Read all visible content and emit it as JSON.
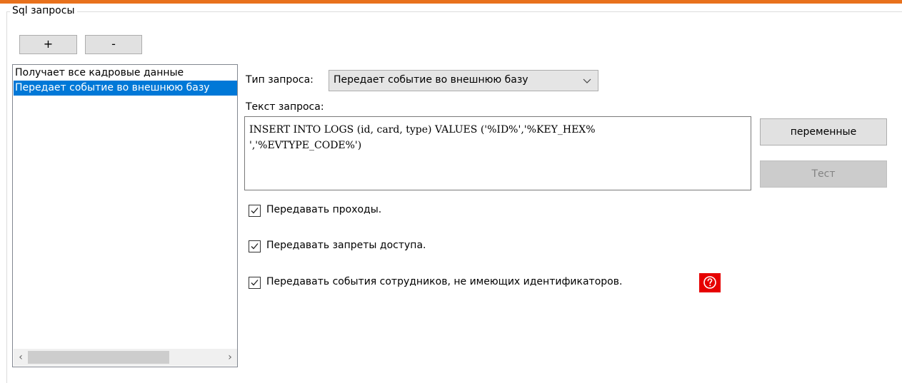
{
  "group": {
    "title": "Sql запросы"
  },
  "buttons": {
    "add": "+",
    "remove": "-",
    "variables": "переменные",
    "test": "Тест"
  },
  "list": {
    "items": [
      "Получает все кадровые данные",
      "Передает событие во внешнюю базу"
    ],
    "selected_index": 1
  },
  "query_type": {
    "label": "Тип запроса:",
    "value": "Передает событие во внешнюю базу"
  },
  "query_text": {
    "label": "Текст запроса:",
    "value": "INSERT INTO LOGS (id, card, type) VALUES ('%ID%','%KEY_HEX%\n','%EVTYPE_CODE%')"
  },
  "checkboxes": [
    {
      "label": "Передавать проходы.",
      "checked": true
    },
    {
      "label": "Передавать запреты доступа.",
      "checked": true
    },
    {
      "label": "Передавать события сотрудников, не имеющих идентификаторов.",
      "checked": true
    }
  ],
  "colors": {
    "accent": "#e8711c",
    "selection": "#0078d7",
    "help": "#e60000"
  },
  "icons": {
    "help": "question-circle-icon",
    "combo_arrow": "chevron-down-icon",
    "check": "checkmark-icon"
  }
}
